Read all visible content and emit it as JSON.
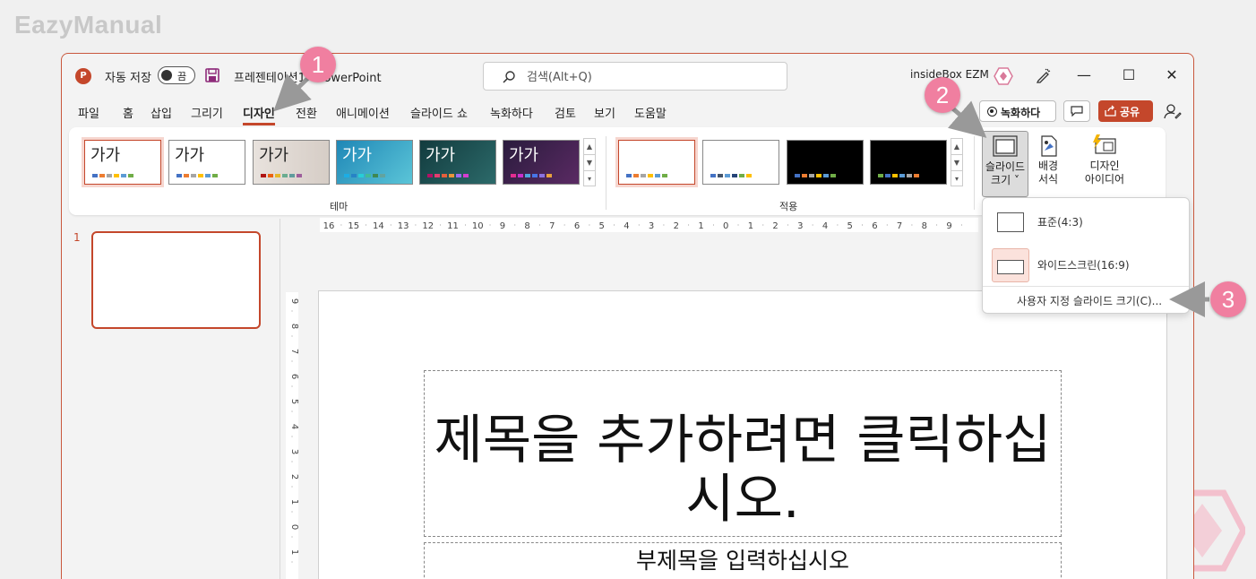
{
  "watermark": {
    "text": "EazyManual"
  },
  "titlebar": {
    "autosave_label": "자동 저장",
    "toggle_state": "끔",
    "doc_title": "프레젠테이션1 - PowerPoint",
    "search_placeholder": "검색(Alt+Q)",
    "account_name": "insideBox EZM",
    "minimize": "—",
    "maximize": "☐",
    "close": "✕"
  },
  "tabs": [
    {
      "label": "파일"
    },
    {
      "label": "홈"
    },
    {
      "label": "삽입"
    },
    {
      "label": "그리기"
    },
    {
      "label": "디자인",
      "active": true
    },
    {
      "label": "전환"
    },
    {
      "label": "애니메이션"
    },
    {
      "label": "슬라이드 쇼"
    },
    {
      "label": "녹화하다"
    },
    {
      "label": "검토"
    },
    {
      "label": "보기"
    },
    {
      "label": "도움말"
    }
  ],
  "header_actions": {
    "record_label": "녹화하다",
    "share_label": "공유"
  },
  "ribbon": {
    "themes_group_label": "테마",
    "variants_group_label": "적용",
    "theme_sample_text": "가가",
    "slide_size_line1": "슬라이드",
    "slide_size_line2": "크기",
    "format_bg_line1": "배경",
    "format_bg_line2": "서식",
    "designer_line1": "디자인",
    "designer_line2": "아이디어"
  },
  "slide_size_menu": {
    "standard": "표준(4:3)",
    "widescreen": "와이드스크린(16:9)",
    "custom": "사용자 지정 슬라이드 크기(C)..."
  },
  "slides_panel": {
    "slide_number": "1"
  },
  "slide": {
    "title_placeholder": "제목을 추가하려면 클릭하십시오.",
    "subtitle_placeholder": "부제목을 입력하십시오"
  },
  "rulers": {
    "horizontal": [
      "16",
      "15",
      "14",
      "13",
      "12",
      "11",
      "10",
      "9",
      "8",
      "7",
      "6",
      "5",
      "4",
      "3",
      "2",
      "1",
      "0",
      "1",
      "2",
      "3",
      "4",
      "5",
      "6",
      "7",
      "8",
      "9"
    ],
    "vertical": [
      "9",
      "8",
      "7",
      "6",
      "5",
      "4",
      "3",
      "2",
      "1",
      "0",
      "1"
    ]
  },
  "callouts": [
    "1",
    "2",
    "3"
  ],
  "colors": {
    "accent": "#c4472b",
    "callout": "#f07fa0"
  }
}
